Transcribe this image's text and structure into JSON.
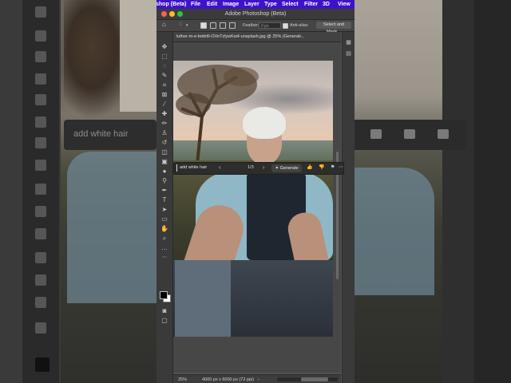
{
  "app": {
    "window_title": "Adobe Photoshop (Beta)",
    "menu": [
      "shop (Beta)",
      "File",
      "Edit",
      "Image",
      "Layer",
      "Type",
      "Select",
      "Filter",
      "3D",
      "View"
    ]
  },
  "options_bar": {
    "feather_label": "Feather:",
    "feather_value": "0 px",
    "anti_alias_label": "Anti-alias",
    "mask_button": "Select and Mask..."
  },
  "document": {
    "tab_title": "luther-m-e-bottrill-OVeTzlywKw4-unsplash.jpg @ 25% (Generati..."
  },
  "contextual_bar": {
    "prompt_value": "add white hair",
    "counter": "1/3",
    "generate_label": "Generate"
  },
  "status_bar": {
    "zoom": "25%",
    "dimensions": "4000 px x 6000 px (72 ppi)"
  },
  "background": {
    "prompt_text": "add white hair"
  },
  "colors": {
    "menubar": "#3d12c9",
    "foreground_color": "#000000",
    "background_color": "#ffffff"
  }
}
